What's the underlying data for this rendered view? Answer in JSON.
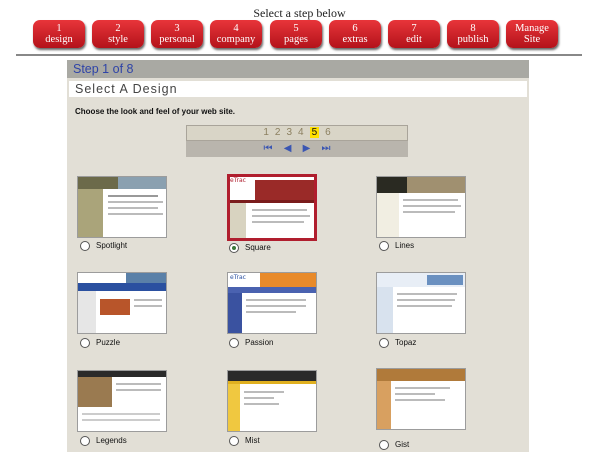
{
  "header": {
    "title": "Select a step below"
  },
  "steps": [
    {
      "num": "1",
      "label": "design"
    },
    {
      "num": "2",
      "label": "style"
    },
    {
      "num": "3",
      "label": "personal"
    },
    {
      "num": "4",
      "label": "company"
    },
    {
      "num": "5",
      "label": "pages"
    },
    {
      "num": "6",
      "label": "extras"
    },
    {
      "num": "7",
      "label": "edit"
    },
    {
      "num": "8",
      "label": "publish"
    },
    {
      "num": "Manage",
      "label": "Site"
    }
  ],
  "panel": {
    "step_title": "Step 1 of 8",
    "section_title": "Select A Design",
    "instructions": "Choose the look and feel of your web site."
  },
  "pager": {
    "pages": [
      "1",
      "2",
      "3",
      "4",
      "5",
      "6"
    ],
    "active_page": "5",
    "nav_first": "⏮",
    "nav_prev": "◀",
    "nav_next": "▶",
    "nav_last": "⏭"
  },
  "designs": [
    {
      "name": "Spotlight",
      "selected": false
    },
    {
      "name": "Square",
      "selected": true
    },
    {
      "name": "Lines",
      "selected": false
    },
    {
      "name": "Puzzle",
      "selected": false
    },
    {
      "name": "Passion",
      "selected": false
    },
    {
      "name": "Topaz",
      "selected": false
    },
    {
      "name": "Legends",
      "selected": false
    },
    {
      "name": "Mist",
      "selected": false
    },
    {
      "name": "Gist",
      "selected": false
    }
  ],
  "thumb_logos": {
    "square": "eTrac",
    "passion": "eTrac"
  },
  "colors": {
    "step_button": "#c8222a",
    "step_title": "#2f44a7",
    "selected_border": "#b01e2e",
    "panel_bg": "#e2dfd6"
  }
}
